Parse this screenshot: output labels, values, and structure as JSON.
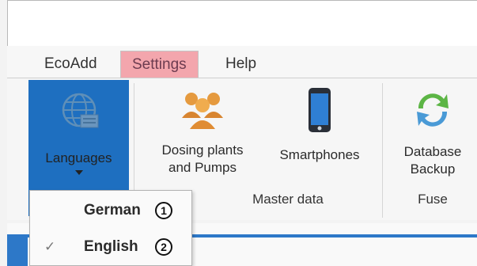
{
  "ribbon_tabs": [
    {
      "label": "EcoAdd"
    },
    {
      "label": "Settings"
    },
    {
      "label": "Help"
    }
  ],
  "buttons": {
    "languages": {
      "label": "Languages",
      "icon": "globe-icon"
    },
    "dosing": {
      "line1": "Dosing plants",
      "line2": "and Pumps",
      "icon": "people-group-icon"
    },
    "smartphones": {
      "label": "Smartphones",
      "icon": "smartphone-icon"
    },
    "backup": {
      "line1": "Database",
      "line2": "Backup",
      "icon": "sync-arrows-icon"
    }
  },
  "groups": {
    "master_data": "Master data",
    "fuse": "Fuse"
  },
  "language_menu": {
    "items": [
      {
        "label": "German",
        "checked": false,
        "callout": "1"
      },
      {
        "label": "English",
        "checked": true,
        "callout": "2",
        "check": "✓"
      }
    ]
  },
  "colors": {
    "selected_button": "#1e6fc0",
    "settings_tab": "#f3a6ad",
    "blue_bar": "#2d78c8"
  }
}
